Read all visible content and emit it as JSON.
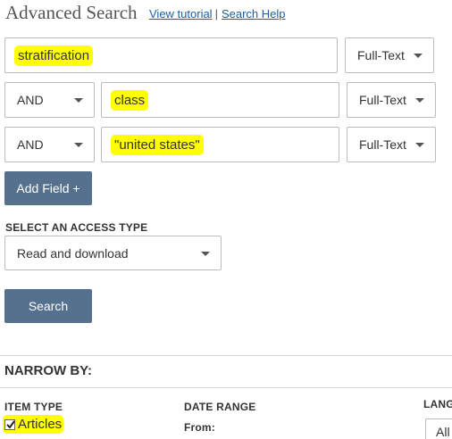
{
  "header": {
    "title": "Advanced Search",
    "view_tutorial": "View tutorial",
    "separator": "|",
    "search_help": "Search Help"
  },
  "search_rows": [
    {
      "operator": null,
      "query": "stratification",
      "field": "Full-Text"
    },
    {
      "operator": "AND",
      "query": "class",
      "field": "Full-Text"
    },
    {
      "operator": "AND",
      "query": "\"united states\"",
      "field": "Full-Text"
    }
  ],
  "add_field_label": "Add Field +",
  "access": {
    "label": "SELECT AN ACCESS TYPE",
    "value": "Read and download"
  },
  "search_button": "Search",
  "narrow": {
    "title": "NARROW BY:",
    "item_type_label": "ITEM TYPE",
    "articles_label": "Articles",
    "articles_checked": true,
    "date_range_label": "DATE RANGE",
    "from_label": "From:",
    "language_label": "LANG",
    "language_value": "All"
  },
  "colors": {
    "highlight": "#ffff00",
    "button": "#55718e",
    "link": "#1a5ea8"
  }
}
